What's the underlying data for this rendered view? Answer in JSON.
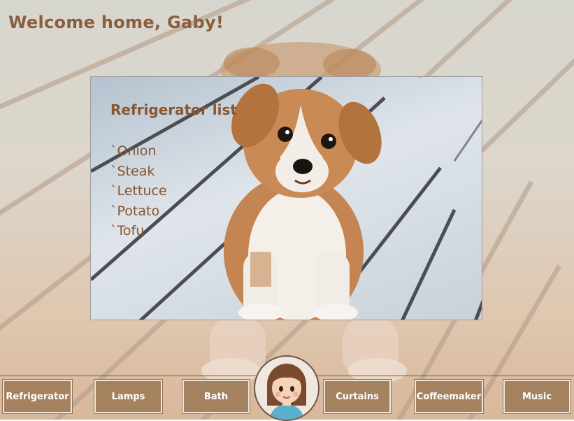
{
  "header": {
    "welcome": "Welcome home, Gaby!"
  },
  "panel": {
    "title": "Refrigerator list",
    "items": [
      "`Onion",
      "`Steak",
      "`Lettuce",
      "`Potato",
      "`Tofu"
    ]
  },
  "nav": {
    "refrigerator": "Refrigerator",
    "lamps": "Lamps",
    "bath": "Bath",
    "curtains": "Curtains",
    "coffeemaker": "Coffeemaker",
    "music": "Music"
  },
  "colors": {
    "accent_text": "#8a5f3e",
    "button_fill": "#a4825f",
    "button_border": "#efe6dd"
  },
  "icons": {
    "avatar": "girl-avatar-icon"
  }
}
